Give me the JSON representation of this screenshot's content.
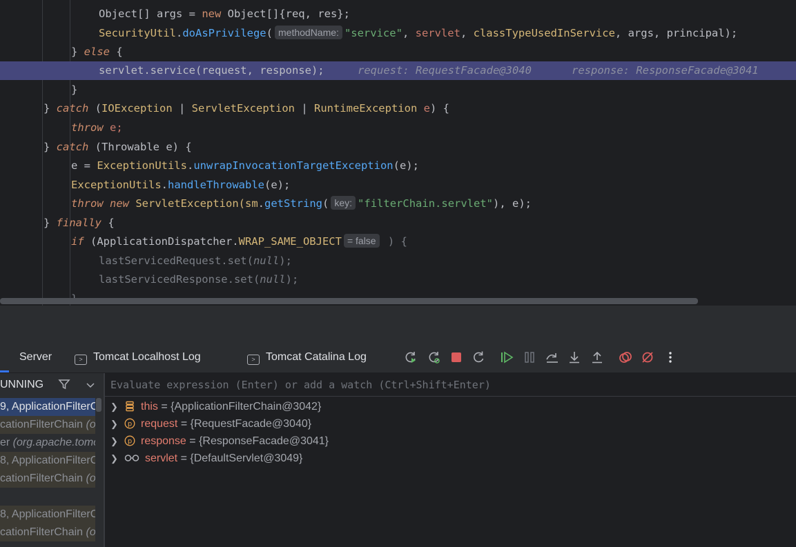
{
  "editor": {
    "line1": {
      "a": "Object[] args = ",
      "kw_new": "new",
      "b": " Object[]{req, res};"
    },
    "line2": {
      "cls": "SecurityUtil",
      "dot": ".",
      "mth": "doAsPrivilege",
      "open": "(",
      "hint": "methodName:",
      "str": "\"service\"",
      "c1": ", ",
      "servlet": "servlet",
      "c2": ", ",
      "classType": "classTypeUsedInService",
      "rest": ", args, principal);"
    },
    "line3": {
      "close": "} ",
      "kw": "else",
      "rest": " {"
    },
    "line4": {
      "code": "servlet.service(request, response);",
      "inline1": "request: RequestFacade@3040",
      "inline2": "response: ResponseFacade@3041"
    },
    "line5": {
      "close": "}"
    },
    "line6": {
      "a": "} ",
      "kw": "catch",
      "b": " (",
      "t1": "IOException",
      "s1": " | ",
      "t2": "ServletException",
      "s2": " | ",
      "t3": "RuntimeException",
      "e": " e",
      "c": ") {"
    },
    "line7": {
      "kw": "throw",
      "b": " e;"
    },
    "line8": {
      "a": "} ",
      "kw": "catch",
      "b": " (Throwable e) {"
    },
    "line9": {
      "a": "e = ",
      "cls": "ExceptionUtils",
      "dot": ".",
      "mth": "unwrapInvocationTargetException",
      "rest": "(e);"
    },
    "line10": {
      "cls": "ExceptionUtils",
      "dot": ".",
      "mth": "handleThrowable",
      "rest": "(e);"
    },
    "line11": {
      "kw1": "throw",
      "sp": " ",
      "kw2": "new",
      "cls": " ServletException(",
      "sm": "sm",
      "dot": ".",
      "mth": "getString",
      "open": "(",
      "hint": "key:",
      "str": "\"filterChain.servlet\"",
      "rest": "), e);"
    },
    "line12": {
      "a": "} ",
      "kw": "finally",
      "b": " {"
    },
    "line13": {
      "kw": "if",
      "a": " (ApplicationDispatcher.",
      "const": "WRAP_SAME_OBJECT",
      "hint": "= false",
      "b": " ) {"
    },
    "line14": {
      "a": "lastServicedRequest.set(",
      "null": "null",
      "b": ");"
    },
    "line15": {
      "a": "lastServicedResponse.set(",
      "null": "null",
      "b": ");"
    },
    "line16": {
      "close": "}"
    }
  },
  "toolbar": {
    "tabs": [
      "Server",
      "Tomcat Localhost Log",
      "Tomcat Catalina Log"
    ],
    "icons": [
      "rerun-icon",
      "rerun-debug-icon",
      "stop-icon",
      "restart-icon",
      "resume-icon",
      "pause-icon",
      "step-over-icon",
      "step-into-icon",
      "step-out-icon",
      "view-breakpoints-icon",
      "mute-breakpoints-icon",
      "more-icon"
    ]
  },
  "frames": {
    "status": "UNNING",
    "items": [
      {
        "text": "9, ApplicationFilterC",
        "style": "sel"
      },
      {
        "text": "cationFilterChain ",
        "italic": "(o",
        "style": "lib"
      },
      {
        "text": "er ",
        "italic": "(org.apache.tomc",
        "style": "plain"
      },
      {
        "text": "8, ApplicationFilterC",
        "style": "lib"
      },
      {
        "text": "cationFilterChain ",
        "italic": "(o",
        "style": "lib"
      },
      {
        "text": "",
        "style": "plain"
      },
      {
        "text": "8, ApplicationFilterC",
        "style": "lib"
      },
      {
        "text": "cationFilterChain ",
        "italic": "(o",
        "style": "lib"
      }
    ]
  },
  "variables": {
    "eval_placeholder": "Evaluate expression (Enter) or add a watch (Ctrl+Shift+Enter)",
    "items": [
      {
        "name": "this",
        "eq": " = ",
        "value": "{ApplicationFilterChain@3042}",
        "icon": "field-stack-icon"
      },
      {
        "name": "request",
        "eq": " = ",
        "value": "{RequestFacade@3040}",
        "icon": "parameter-icon"
      },
      {
        "name": "response",
        "eq": " = ",
        "value": "{ResponseFacade@3041}",
        "icon": "parameter-icon"
      },
      {
        "name": "servlet",
        "eq": " = ",
        "value": "{DefaultServlet@3049}",
        "icon": "watch-glasses-icon"
      }
    ]
  },
  "colors": {
    "accent": "#3574f0",
    "exec_line": "#45477c",
    "keyword": "#cf8e6d",
    "string": "#6aab73",
    "method": "#56a8f5"
  }
}
